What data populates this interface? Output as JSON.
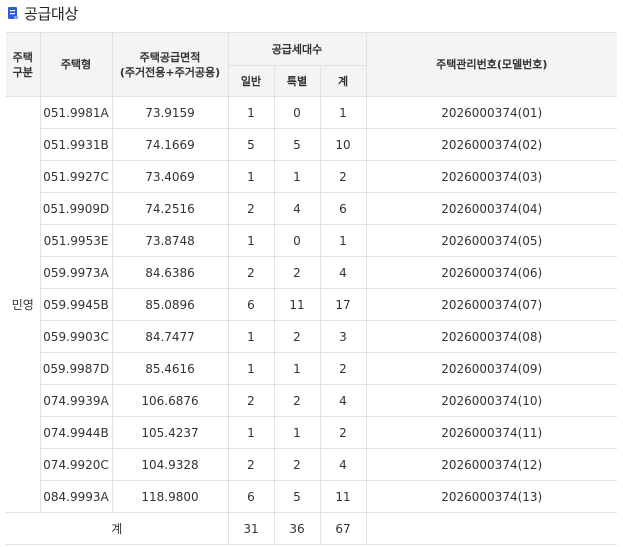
{
  "section": {
    "title": "공급대상",
    "icon": "document-icon",
    "accent_color": "#2d5fd4"
  },
  "table": {
    "headers": {
      "housing_category_line1": "주택",
      "housing_category_line2": "구분",
      "housing_type": "주택형",
      "area_line1": "주택공급면적",
      "area_line2": "(주거전용+주거공용)",
      "units_group": "공급세대수",
      "units_general": "일반",
      "units_special": "특별",
      "units_total": "계",
      "model_number": "주택관리번호(모델번호)"
    },
    "category": "민영",
    "rows": [
      {
        "type": "051.9981A",
        "area": "73.9159",
        "general": "1",
        "special": "0",
        "total": "1",
        "model": "2026000374(01)"
      },
      {
        "type": "051.9931B",
        "area": "74.1669",
        "general": "5",
        "special": "5",
        "total": "10",
        "model": "2026000374(02)"
      },
      {
        "type": "051.9927C",
        "area": "73.4069",
        "general": "1",
        "special": "1",
        "total": "2",
        "model": "2026000374(03)"
      },
      {
        "type": "051.9909D",
        "area": "74.2516",
        "general": "2",
        "special": "4",
        "total": "6",
        "model": "2026000374(04)"
      },
      {
        "type": "051.9953E",
        "area": "73.8748",
        "general": "1",
        "special": "0",
        "total": "1",
        "model": "2026000374(05)"
      },
      {
        "type": "059.9973A",
        "area": "84.6386",
        "general": "2",
        "special": "2",
        "total": "4",
        "model": "2026000374(06)"
      },
      {
        "type": "059.9945B",
        "area": "85.0896",
        "general": "6",
        "special": "11",
        "total": "17",
        "model": "2026000374(07)"
      },
      {
        "type": "059.9903C",
        "area": "84.7477",
        "general": "1",
        "special": "2",
        "total": "3",
        "model": "2026000374(08)"
      },
      {
        "type": "059.9987D",
        "area": "85.4616",
        "general": "1",
        "special": "1",
        "total": "2",
        "model": "2026000374(09)"
      },
      {
        "type": "074.9939A",
        "area": "106.6876",
        "general": "2",
        "special": "2",
        "total": "4",
        "model": "2026000374(10)"
      },
      {
        "type": "074.9944B",
        "area": "105.4237",
        "general": "1",
        "special": "1",
        "total": "2",
        "model": "2026000374(11)"
      },
      {
        "type": "074.9920C",
        "area": "104.9328",
        "general": "2",
        "special": "2",
        "total": "4",
        "model": "2026000374(12)"
      },
      {
        "type": "084.9993A",
        "area": "118.9800",
        "general": "6",
        "special": "5",
        "total": "11",
        "model": "2026000374(13)"
      }
    ],
    "footer": {
      "label": "계",
      "general": "31",
      "special": "36",
      "total": "67"
    }
  }
}
